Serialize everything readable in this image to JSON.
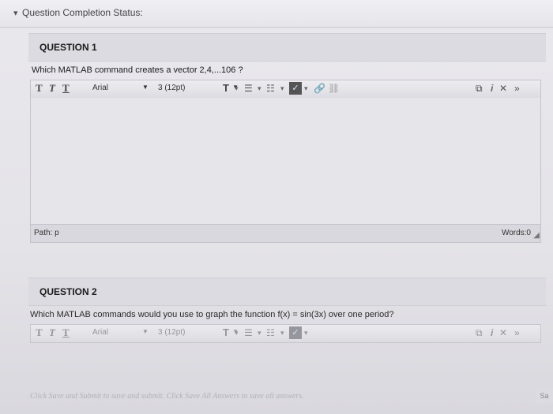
{
  "status": {
    "toggle_icon": "▾",
    "label": "Question Completion Status:"
  },
  "questions": [
    {
      "heading": "QUESTION 1",
      "text": "Which MATLAB command creates a vector 2,4,...106 ?",
      "toolbar": {
        "t1": "T",
        "t2": "T",
        "t3": "T",
        "font": "Arial",
        "size": "3 (12pt)",
        "color_t": "T",
        "right_icons": [
          "⧉",
          "i",
          "✕",
          "»"
        ]
      },
      "path_label": "Path: p",
      "words_label": "Words:0"
    },
    {
      "heading": "QUESTION 2",
      "text": "Which MATLAB commands would you use to graph the function f(x) = sin(3x) over one period?",
      "toolbar": {
        "t1": "T",
        "t2": "T",
        "t3": "T",
        "font": "Arial",
        "size": "3 (12pt)",
        "color_t": "T",
        "right_icons": [
          "⧉",
          "i",
          "✕",
          "»"
        ]
      }
    }
  ],
  "footer": {
    "message": "Click Save and Submit to save and submit. Click Save All Answers to save all answers.",
    "side_button": "Sa"
  }
}
